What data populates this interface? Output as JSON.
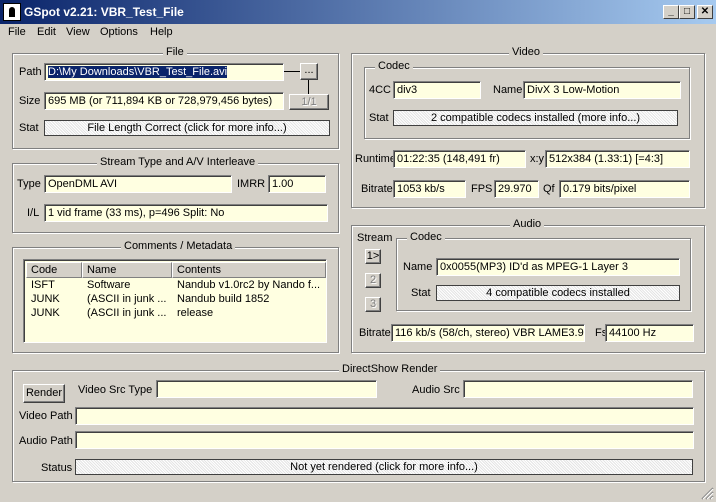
{
  "window": {
    "title": "GSpot v2.21: VBR_Test_File",
    "minimize": "_",
    "maximize": "□",
    "close": "✕"
  },
  "menu": [
    "File",
    "Edit",
    "View",
    "Options",
    "Help"
  ],
  "file_group": {
    "title": "File",
    "path_label": "Path",
    "path_value": "D:\\My Downloads\\VBR_Test_File.avi",
    "browse_label": "...",
    "size_label": "Size",
    "size_value": "695 MB (or 711,894 KB or 728,979,456 bytes)",
    "counter": "1/1",
    "stat_label": "Stat",
    "stat_value": "File Length Correct (click for more info...)"
  },
  "stream_group": {
    "title": "Stream Type and A/V Interleave",
    "type_label": "Type",
    "type_value": "OpenDML AVI",
    "imrr_label": "IMRR",
    "imrr_value": "1.00",
    "il_label": "I/L",
    "il_value": "1 vid frame (33 ms), p=496  Split: No"
  },
  "comments_group": {
    "title": "Comments / Metadata",
    "columns": [
      "Code",
      "Name",
      "Contents"
    ],
    "rows": [
      [
        "ISFT",
        "Software",
        "Nandub v1.0rc2  by Nando f..."
      ],
      [
        "JUNK",
        "(ASCII in junk ...",
        "Nandub build 1852"
      ],
      [
        "JUNK",
        "(ASCII in junk ...",
        "release"
      ]
    ]
  },
  "video_group": {
    "title": "Video",
    "codec_title": "Codec",
    "fourcc_label": "4CC",
    "fourcc_value": "div3",
    "name_label": "Name",
    "name_value": "DivX 3 Low-Motion",
    "stat_label": "Stat",
    "stat_value": "2 compatible codecs installed (more info...)",
    "runtime_label": "Runtime",
    "runtime_value": "01:22:35 (148,491 fr)",
    "xy_label": "x:y",
    "xy_value": "512x384 (1.33:1) [=4:3]",
    "bitrate_label": "Bitrate",
    "bitrate_value": "1053 kb/s",
    "fps_label": "FPS",
    "fps_value": "29.970",
    "qf_label": "Qf",
    "qf_value": "0.179 bits/pixel"
  },
  "audio_group": {
    "title": "Audio",
    "stream_label": "Stream",
    "streams": [
      "1>",
      "2",
      "3"
    ],
    "codec_title": "Codec",
    "name_label": "Name",
    "name_value": "0x0055(MP3) ID'd as MPEG-1 Layer 3",
    "stat_label": "Stat",
    "stat_value": "4 compatible codecs installed",
    "bitrate_label": "Bitrate",
    "bitrate_value": "116 kb/s (58/ch, stereo) VBR LAME3.9",
    "fs_label": "Fs",
    "fs_value": "44100 Hz"
  },
  "directshow_group": {
    "title": "DirectShow Render",
    "render_label": "Render",
    "video_src_type_label": "Video Src Type",
    "video_src_type_value": "",
    "audio_src_label": "Audio Src",
    "audio_src_value": "",
    "video_path_label": "Video Path",
    "video_path_value": "",
    "audio_path_label": "Audio Path",
    "audio_path_value": "",
    "status_label": "Status",
    "status_value": "Not yet rendered (click for more info...)"
  }
}
